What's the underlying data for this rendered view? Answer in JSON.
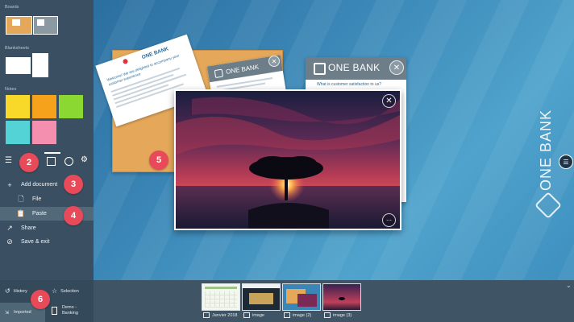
{
  "sidebar": {
    "sections": {
      "boards": "Boards",
      "blanksheets": "Blanksheets",
      "notes": "Notes"
    },
    "note_colors": [
      "#f8d92a",
      "#f7a21b",
      "#8bd832",
      "#54d3d6",
      "#f58fb0"
    ],
    "menu": {
      "add_document": "Add document",
      "file": "File",
      "paste": "Paste",
      "share": "Share",
      "save_exit": "Save & exit"
    },
    "bottom": {
      "history": "History",
      "selection": "Selection",
      "imported": "Imported",
      "demo_banking_line1": "Demo -",
      "demo_banking_line2": "Banking"
    }
  },
  "badges": [
    "2",
    "3",
    "4",
    "5",
    "6"
  ],
  "canvas": {
    "brand": "ONE BANK",
    "doc_card": {
      "brand": "ONE BANK",
      "question": "What is customer satisfaction to us?"
    },
    "small_card": {
      "brand": "ONE BANK"
    },
    "tilted_note": {
      "brand": "ONE BANK",
      "heading": "Welcome! We are delighted to accompany your customer experience"
    }
  },
  "thumbnails": [
    {
      "label": "Janvier 2018"
    },
    {
      "label": "image"
    },
    {
      "label": "image (2)"
    },
    {
      "label": "image (3)"
    }
  ],
  "colors": {
    "accent_badge": "#e94a5a",
    "sidebar_bg": "#3a5062",
    "board_cork": "#e5a85a"
  },
  "icons": {
    "hamburger": "hamburger-icon",
    "layout": "layout-icon",
    "palette": "palette-icon",
    "settings": "gear-icon"
  }
}
